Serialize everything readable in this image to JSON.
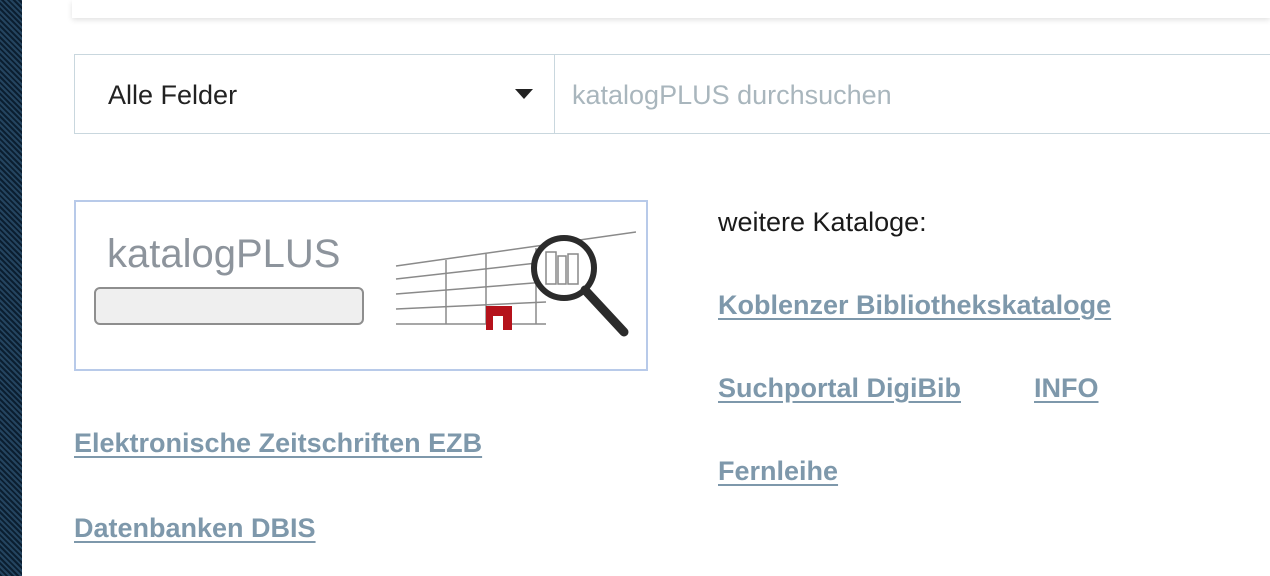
{
  "search": {
    "field_value": "Alle Felder",
    "placeholder": "katalogPLUS durchsuchen"
  },
  "logo": {
    "text": "katalogPLUS"
  },
  "links_left": {
    "ezb": "Elektronische Zeitschriften EZB",
    "dbis": "Datenbanken DBIS"
  },
  "more_catalogs": {
    "heading": "weitere Kataloge:",
    "koblenz": "Koblenzer Bibliothekskataloge",
    "digibib": "Suchportal DigiBib",
    "info": "INFO",
    "fernleihe": "Fernleihe"
  },
  "colors": {
    "link": "#7e98ab",
    "accent_red": "#b5121b",
    "frame_border": "#b8cae9"
  },
  "icons": [
    "chevron-down-icon",
    "magnifier-icon"
  ]
}
